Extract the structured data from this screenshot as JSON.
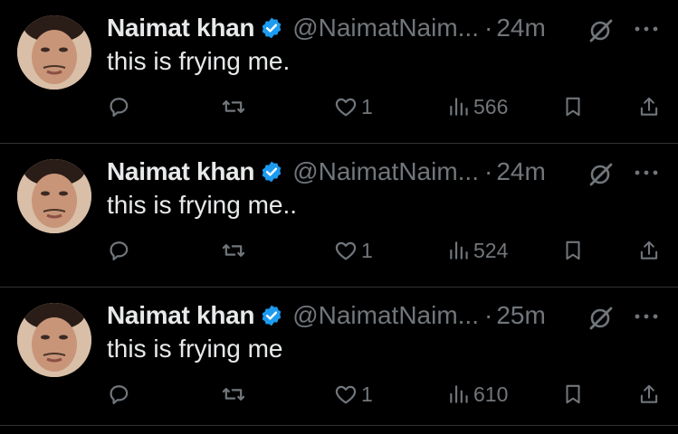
{
  "tweets": [
    {
      "name": "Naimat khan",
      "handle": "@NaimatNaim...",
      "separator": "·",
      "time": "24m",
      "text": "this is frying me.",
      "likes": "1",
      "views": "566"
    },
    {
      "name": "Naimat khan",
      "handle": "@NaimatNaim...",
      "separator": "·",
      "time": "24m",
      "text": "this is frying me..",
      "likes": "1",
      "views": "524"
    },
    {
      "name": "Naimat khan",
      "handle": "@NaimatNaim...",
      "separator": "·",
      "time": "25m",
      "text": "this is frying me",
      "likes": "1",
      "views": "610"
    }
  ],
  "icons": {
    "verified": "verified-badge-icon",
    "grok": "grok-icon",
    "more": "more-horizontal-icon",
    "reply": "reply-icon",
    "retweet": "retweet-icon",
    "like": "heart-icon",
    "views": "views-chart-icon",
    "bookmark": "bookmark-icon",
    "share": "share-icon"
  },
  "colors": {
    "background": "#000000",
    "primary_text": "#e7e9ea",
    "secondary_text": "#71767b",
    "verified": "#1d9bf0",
    "divider": "#2f3336"
  }
}
